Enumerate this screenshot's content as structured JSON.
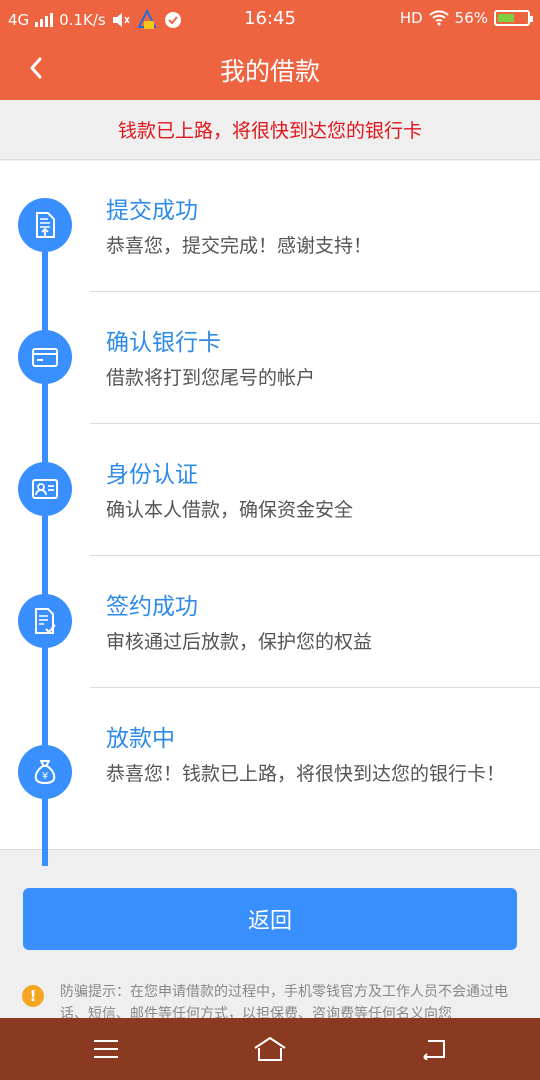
{
  "status_bar": {
    "network": "4G",
    "speed": "0.1K/s",
    "time": "16:45",
    "hd": "HD",
    "battery": "56%",
    "battery_level": 0.56
  },
  "header": {
    "title": "我的借款",
    "back_icon": "chevron-left-icon"
  },
  "notice": "钱款已上路，将很快到达您的银行卡",
  "steps": [
    {
      "title": "提交成功",
      "desc": "恭喜您，提交完成！感谢支持！",
      "icon": "document-upload-icon"
    },
    {
      "title": "确认银行卡",
      "desc": "借款将打到您尾号的帐户",
      "icon": "bank-card-icon"
    },
    {
      "title": "身份认证",
      "desc": "确认本人借款，确保资金安全",
      "icon": "id-card-icon"
    },
    {
      "title": "签约成功",
      "desc": "审核通过后放款，保护您的权益",
      "icon": "contract-signed-icon"
    },
    {
      "title": "放款中",
      "desc": "恭喜您！钱款已上路，将很快到达您的银行卡！",
      "icon": "money-bag-icon"
    }
  ],
  "return_button": "返回",
  "fraud_tip": {
    "icon": "warning-icon",
    "text": "防骗提示：在您申请借款的过程中，手机零钱官方及工作人员不会通过电话、短信、邮件等任何方式，以担保费、咨询费等任何名义向您"
  },
  "colors": {
    "brand": "#ee6441",
    "accent": "#3a8fff",
    "notice": "#e0161c",
    "navbar": "#8b3a22"
  },
  "nav": [
    "menu-icon",
    "home-icon",
    "back-icon"
  ]
}
